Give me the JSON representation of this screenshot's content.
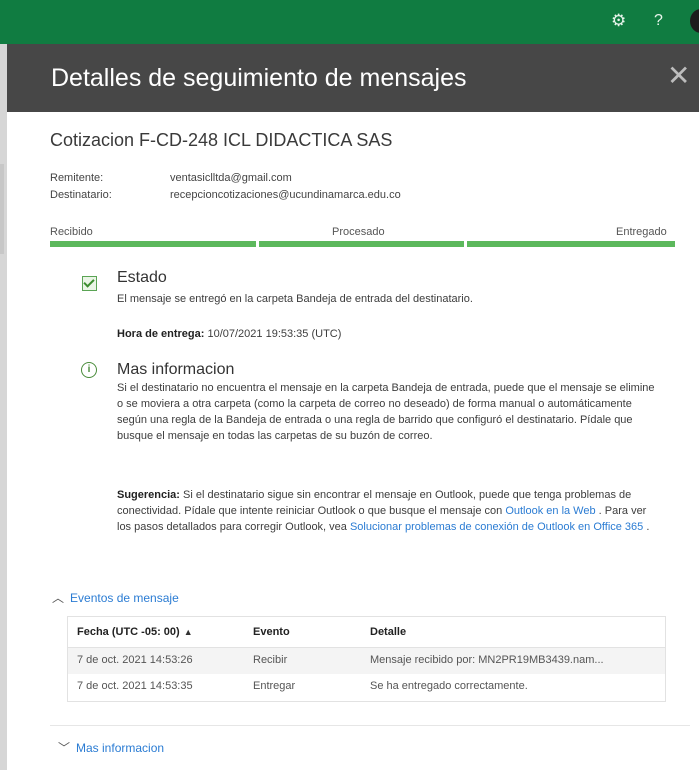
{
  "topbar": {
    "gear_icon": "⚙",
    "help_icon": "?",
    "color": "#107c41"
  },
  "panel": {
    "title": "Detalles de seguimiento de mensajes",
    "close_icon": "✕"
  },
  "message": {
    "subject": "Cotizacion F-CD-248 ICL DIDACTICA SAS",
    "sender_label": "Remitente:",
    "sender": "ventasiclltda@gmail.com",
    "recipient_label": "Destinatario:",
    "recipient": "recepcioncotizaciones@ucundinamarca.edu.co"
  },
  "progress": {
    "stages": [
      "Recibido",
      "Procesado",
      "Entregado"
    ],
    "color": "#5cb85c"
  },
  "status": {
    "heading": "Estado",
    "text": "El mensaje se entregó en la carpeta Bandeja de entrada del destinatario.",
    "delivery_label": "Hora de entrega:",
    "delivery_value": " 10/07/2021 19:53:35 (UTC)"
  },
  "more_info": {
    "heading": "Mas informacion",
    "paragraph": "Si el destinatario no encuentra el mensaje en la carpeta Bandeja de entrada, puede que el mensaje se elimine o se moviera a otra carpeta (como la carpeta de correo no deseado) de forma manual o automáticamente según una regla de la Bandeja de entrada o una regla de barrido que configuró el destinatario. Pídale que busque el mensaje en todas las carpetas de su buzón de correo.",
    "suggestion_label": "Sugerencia:",
    "suggestion_text": " Si el destinatario sigue sin encontrar el mensaje en Outlook, puede que tenga problemas de conectividad. Pídale que intente reiniciar Outlook o que busque el mensaje con ",
    "outlook_web_link": "Outlook en la Web",
    "suggestion_text2": " . Para ver los pasos detallados para corregir Outlook, vea ",
    "solve_link": "Solucionar problemas de conexión de Outlook en Office 365",
    "suggestion_end": " ."
  },
  "events": {
    "toggle_label": "Eventos de mensaje",
    "columns": [
      "Fecha (UTC -05: 00)",
      "Evento",
      "Detalle"
    ],
    "sort_icon": "▲",
    "rows": [
      {
        "date": "7 de oct. 2021 14:53:26",
        "event": "Recibir",
        "detail": "Mensaje recibido por: MN2PR19MB3439.nam..."
      },
      {
        "date": "7 de oct. 2021 14:53:35",
        "event": "Entregar",
        "detail": "Se ha entregado correctamente."
      }
    ]
  },
  "footer": {
    "more_label": "Mas informacion"
  }
}
